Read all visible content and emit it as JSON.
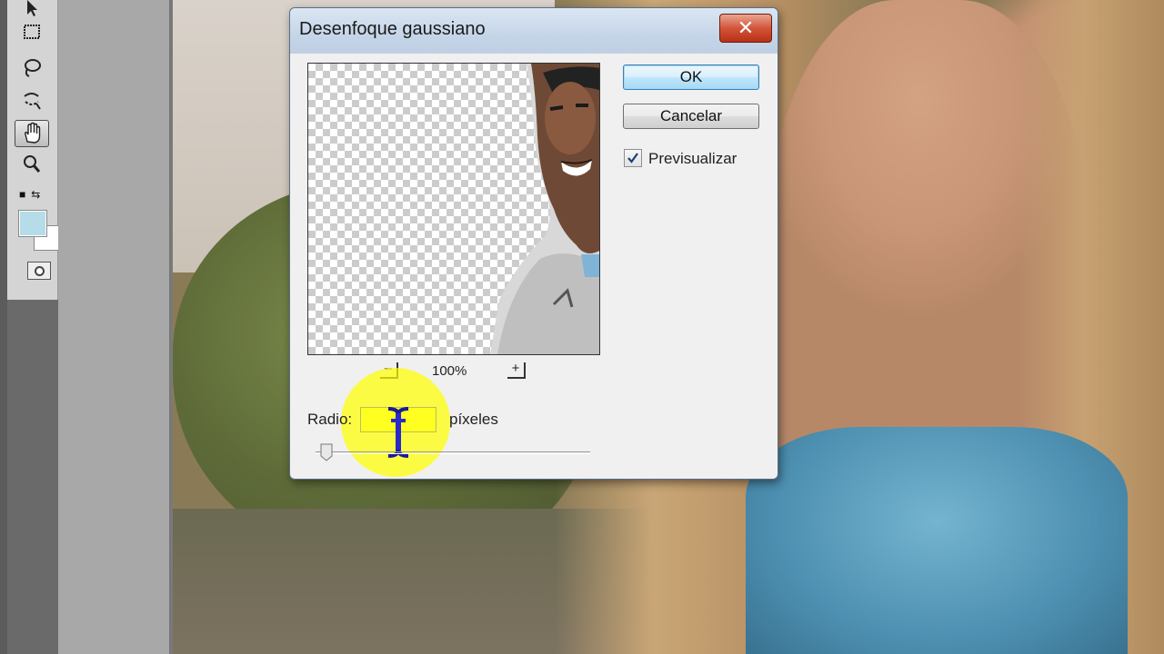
{
  "dialog": {
    "title": "Desenfoque gaussiano",
    "close_glyph": "✕",
    "ok_label": "OK",
    "cancel_label": "Cancelar",
    "preview_checkbox": {
      "label": "Previsualizar",
      "checked": true
    },
    "zoom": {
      "minus": "–",
      "value": "100%",
      "plus": "+"
    },
    "radius": {
      "label": "Radio:",
      "value": "",
      "units": "píxeles"
    },
    "slider_level": 0.04
  },
  "toolbar": {
    "tools": [
      "move-icon",
      "marquee-icon",
      "lasso-icon",
      "quick-select-icon",
      "hand-icon",
      "zoom-icon"
    ],
    "active_tool": "hand-icon",
    "foreground_color": "#b6dce9",
    "background_color": "#ffffff"
  },
  "colors": {
    "titlebar": "#c5d5e8",
    "close": "#d2553a",
    "highlight": "#ffff00"
  }
}
